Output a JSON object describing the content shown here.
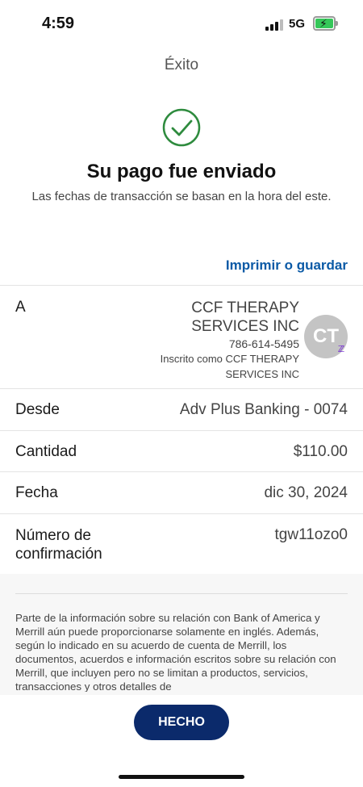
{
  "status_bar": {
    "time": "4:59",
    "network": "5G"
  },
  "nav": {
    "title": "Éxito"
  },
  "confirmation": {
    "headline": "Su pago fue enviado",
    "subtext": "Las fechas de transacción se basan en la hora del este."
  },
  "actions": {
    "print_label": "Imprimir o guardar",
    "done_label": "HECHO"
  },
  "details": {
    "to": {
      "label": "A",
      "payee_line1": "CCF THERAPY",
      "payee_line2": "SERVICES INC",
      "phone": "786-614-5495",
      "enrolled_line1": "Inscrito como CCF THERAPY",
      "enrolled_line2": "SERVICES INC",
      "avatar_initials": "CT",
      "badge_icon": "zelle-icon"
    },
    "from": {
      "label": "Desde",
      "value": "Adv Plus Banking - 0074"
    },
    "amount": {
      "label": "Cantidad",
      "value": "$110.00"
    },
    "date": {
      "label": "Fecha",
      "value": "dic 30, 2024"
    },
    "confirmation_number": {
      "label_line1": "Número de",
      "label_line2": "confirmación",
      "value": "tgw11ozo0"
    }
  },
  "disclaimer": "Parte de la información sobre su relación con Bank of America y Merrill aún puede proporcionarse solamente en inglés. Además, según lo indicado en su acuerdo de cuenta de Merrill, los documentos, acuerdos e información escritos sobre su relación con Merrill, que incluyen pero no se limitan a productos, servicios, transacciones y otros detalles de",
  "colors": {
    "accent_blue": "#0b5aa6",
    "button_navy": "#0b2a6b",
    "success_green": "#2e8b3e",
    "zelle_purple": "#6d1ed4"
  }
}
